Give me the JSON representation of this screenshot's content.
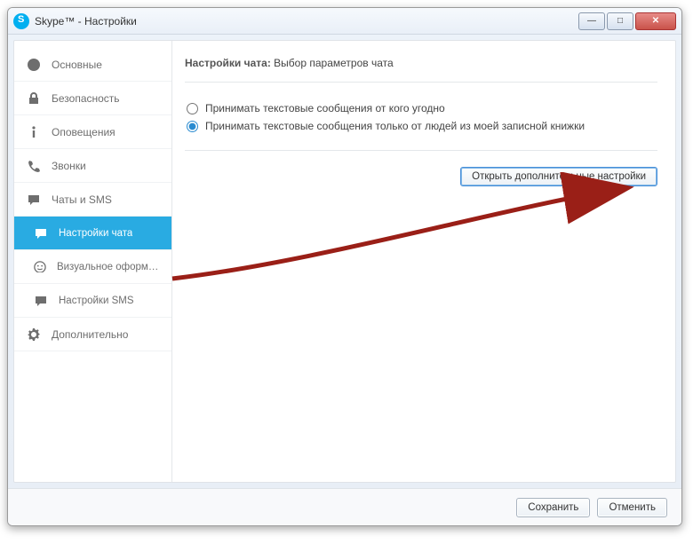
{
  "window": {
    "title": "Skype™ - Настройки"
  },
  "sidebar": {
    "items": [
      {
        "label": "Основные"
      },
      {
        "label": "Безопасность"
      },
      {
        "label": "Оповещения"
      },
      {
        "label": "Звонки"
      },
      {
        "label": "Чаты и SMS"
      },
      {
        "label": "Настройки чата"
      },
      {
        "label": "Визуальное оформлен..."
      },
      {
        "label": "Настройки SMS"
      },
      {
        "label": "Дополнительно"
      }
    ]
  },
  "pane": {
    "heading_strong": "Настройки чата:",
    "heading_rest": " Выбор параметров чата",
    "radio1": "Принимать текстовые сообщения от кого угодно",
    "radio2": "Принимать текстовые сообщения только от людей из моей записной книжки",
    "advanced_button": "Открыть дополнительные настройки"
  },
  "footer": {
    "save": "Сохранить",
    "cancel": "Отменить"
  }
}
